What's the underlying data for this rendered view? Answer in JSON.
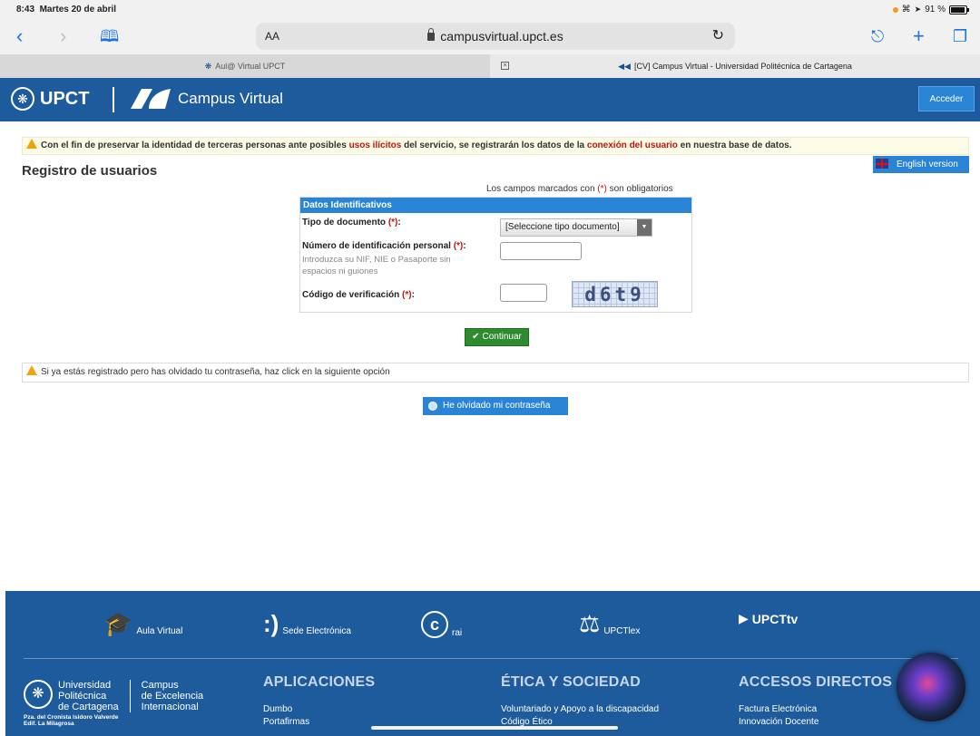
{
  "status_bar": {
    "time": "8:43",
    "date": "Martes 20 de abril",
    "signal": "• · ↗",
    "battery": "91 %"
  },
  "toolbar": {
    "text_size": "AA",
    "url": "campusvirtual.upct.es"
  },
  "tabs": [
    {
      "label": "Aul@ Virtual UPCT"
    },
    {
      "label": "[CV] Campus Virtual - Universidad Politécnica de Cartagena"
    }
  ],
  "header": {
    "brand": "UPCT",
    "product": "Campus Virtual",
    "login_label": "Acceder"
  },
  "warning": {
    "part1": "Con el fin de preservar la identidad de terceras personas ante posibles ",
    "highlight1": "usos ilícitos",
    "part2": " del servicio, se registrarán los datos de la ",
    "highlight2": "conexión del usuario",
    "part3": " en nuestra base de datos."
  },
  "page": {
    "title": "Registro de usuarios",
    "english_label": "English version"
  },
  "form": {
    "note_prefix": "Los campos marcados con ",
    "required_mark": "(*)",
    "note_suffix": " son obligatorios",
    "section_title": "Datos Identificativos",
    "doc_type_label": "Tipo de documento ",
    "doc_type_value": "[Seleccione tipo documento]",
    "id_label": "Número de identificación personal ",
    "id_help": "Introduzca su NIF, NIE o Pasaporte sin espacios ni guiones",
    "code_label": "Código de verificación ",
    "captcha_text": "d6t9",
    "continue_label": "Continuar"
  },
  "recovery": {
    "message": "Si ya estás registrado pero has olvidado tu contraseña, haz click en la siguiente opción",
    "button_label": "He olvidado mi contraseña"
  },
  "footer": {
    "links": [
      {
        "label": "Aula Virtual"
      },
      {
        "label": "Sede Electrónica"
      },
      {
        "label": "rai"
      },
      {
        "label": "UPCTlex"
      },
      {
        "label": "UPCTtv"
      }
    ],
    "university": {
      "line1": "Universidad",
      "line2": "Politécnica",
      "line3": "de Cartagena",
      "campus1": "Campus",
      "campus2": "de Excelencia",
      "campus3": "Internacional"
    },
    "address": {
      "line1": "Pza. del Cronista Isidoro Valverde",
      "line2": "Edif. La Milagrosa"
    },
    "columns": [
      {
        "title": "APLICACIONES",
        "items": [
          "Dumbo",
          "Portafirmas"
        ]
      },
      {
        "title": "ÉTICA Y SOCIEDAD",
        "items": [
          "Voluntariado y Apoyo a la discapacidad",
          "Código Ético"
        ]
      },
      {
        "title": "ACCESOS DIRECTOS",
        "items": [
          "Factura Electrónica",
          "Innovación Docente"
        ]
      }
    ]
  }
}
